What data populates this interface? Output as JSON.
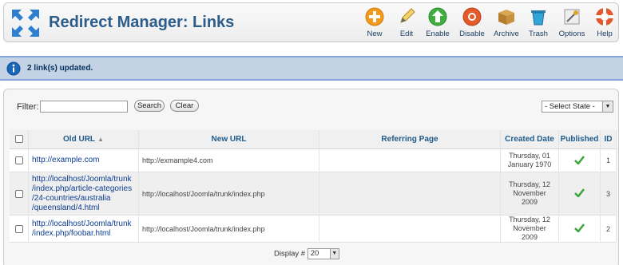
{
  "header": {
    "title": "Redirect Manager: Links"
  },
  "toolbar": {
    "buttons": [
      {
        "label": "New",
        "icon": "new-icon"
      },
      {
        "label": "Edit",
        "icon": "edit-icon"
      },
      {
        "label": "Enable",
        "icon": "enable-icon"
      },
      {
        "label": "Disable",
        "icon": "disable-icon"
      },
      {
        "label": "Archive",
        "icon": "archive-icon"
      },
      {
        "label": "Trash",
        "icon": "trash-icon"
      },
      {
        "label": "Options",
        "icon": "options-icon"
      },
      {
        "label": "Help",
        "icon": "help-icon"
      }
    ]
  },
  "message": {
    "text": "2 link(s) updated."
  },
  "filter": {
    "label": "Filter:",
    "value": "",
    "search_label": "Search",
    "clear_label": "Clear",
    "state_select": "- Select State -"
  },
  "table": {
    "columns": {
      "old_url": "Old URL",
      "new_url": "New URL",
      "referring_page": "Referring Page",
      "created_date": "Created Date",
      "published": "Published",
      "id": "ID"
    },
    "rows": [
      {
        "old_url": [
          "http://example.com"
        ],
        "new_url": "http://exmample4.com",
        "referring_page": "",
        "created_date": [
          "Thursday, 01",
          "January 1970"
        ],
        "published": true,
        "id": "1"
      },
      {
        "old_url": [
          "http://localhost/Joomla/trunk",
          "/index.php/article-categories",
          "/24-countries/australia",
          "/queensland/4.html"
        ],
        "new_url": "http://localhost/Joomla/trunk/index.php",
        "referring_page": "",
        "created_date": [
          "Thursday, 12",
          "November 2009"
        ],
        "published": true,
        "id": "3"
      },
      {
        "old_url": [
          "http://localhost/Joomla/trunk",
          "/index.php/foobar.html"
        ],
        "new_url": "http://localhost/Joomla/trunk/index.php",
        "referring_page": "",
        "created_date": [
          "Thursday, 12",
          "November 2009"
        ],
        "published": true,
        "id": "2"
      }
    ]
  },
  "pagination": {
    "display_label": "Display #",
    "limit": "20"
  },
  "colors": {
    "title": "#2b5c8a",
    "link": "#0b3d91",
    "message_bg": "#c3d2e5",
    "check": "#3aa53a"
  }
}
